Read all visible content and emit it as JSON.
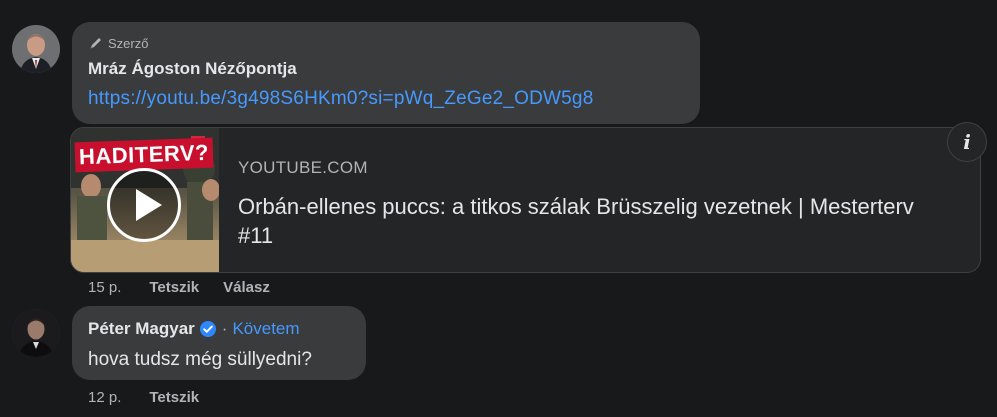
{
  "comment1": {
    "author_badge": "Szerző",
    "name": "Mráz Ágoston Nézőpontja",
    "link": "https://youtu.be/3g498S6HKm0?si=pWq_ZeGe2_ODW5g8",
    "preview": {
      "thumb_title": "HADITERV?",
      "domain": "YOUTUBE.COM",
      "title": "Orbán-ellenes puccs: a titkos szálak Brüsszelig vezetnek | Mesterterv #11"
    },
    "time": "15 p.",
    "like_label": "Tetszik",
    "reply_label": "Válasz"
  },
  "comment2": {
    "name": "Péter Magyar",
    "separator": "·",
    "follow_label": "Követem",
    "text": "hova tudsz még süllyedni?",
    "time": "12 p.",
    "like_label": "Tetszik"
  },
  "info_icon_glyph": "i",
  "colors": {
    "background": "#18191a",
    "bubble": "#3a3b3c",
    "link": "#4599ff",
    "verified": "#2d88ff"
  }
}
